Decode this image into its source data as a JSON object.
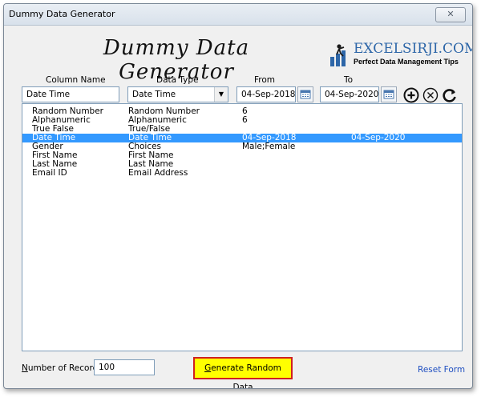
{
  "window": {
    "title": "Dummy Data Generator",
    "close_glyph": "✕"
  },
  "heading": "Dummy Data Generator",
  "logo": {
    "name": "EXCELSIRJI.COM",
    "tagline": "Perfect Data Management Tips",
    "icon": "person-climbing-bars-icon"
  },
  "columns": {
    "column_name": "Column Name",
    "data_type": "Data Type",
    "from": "From",
    "to": "To"
  },
  "inputs": {
    "column_name_value": "Date Time",
    "data_type_value": "Date Time",
    "from_value": "04-Sep-2018",
    "to_value": "04-Sep-2020"
  },
  "actions": {
    "add": "add-circle-icon",
    "remove": "remove-circle-icon",
    "refresh": "refresh-icon"
  },
  "rows": [
    {
      "name": "Random Number",
      "type": "Random Number",
      "from": "6",
      "to": "",
      "selected": false
    },
    {
      "name": "Alphanumeric",
      "type": "Alphanumeric",
      "from": "6",
      "to": "",
      "selected": false
    },
    {
      "name": "True False",
      "type": "True/False",
      "from": "",
      "to": "",
      "selected": false
    },
    {
      "name": "Date Time",
      "type": "Date Time",
      "from": "04-Sep-2018",
      "to": "04-Sep-2020",
      "selected": true
    },
    {
      "name": "Gender",
      "type": "Choices",
      "from": "Male;Female",
      "to": "",
      "selected": false
    },
    {
      "name": "First Name",
      "type": "First Name",
      "from": "",
      "to": "",
      "selected": false
    },
    {
      "name": "Last Name",
      "type": "Last Name",
      "from": "",
      "to": "",
      "selected": false
    },
    {
      "name": "Email ID",
      "type": "Email Address",
      "from": "",
      "to": "",
      "selected": false
    }
  ],
  "footer": {
    "records_label_first": "N",
    "records_label_rest": "umber of Records:",
    "records_value": "100",
    "generate_first": "G",
    "generate_rest": "enerate Random Data",
    "reset": "Reset Form"
  },
  "colors": {
    "selection": "#3399ff",
    "generate_bg": "#ffff00",
    "generate_border": "#d02020",
    "link": "#1f4fc1"
  }
}
